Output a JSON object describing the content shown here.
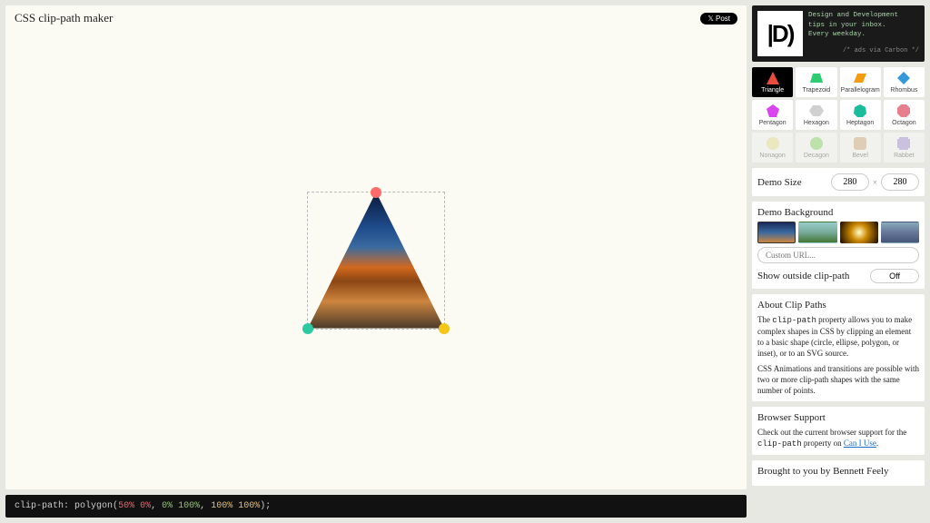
{
  "header": {
    "title": "CSS clip-path maker",
    "post_label": "Post"
  },
  "ad": {
    "line1": "Design and Development",
    "line2": "tips in your inbox.",
    "line3": "Every weekday.",
    "via": "/* ads via Carbon */"
  },
  "shapes": [
    {
      "name": "Triangle",
      "color": "#e74c3c",
      "active": true
    },
    {
      "name": "Trapezoid",
      "color": "#2ecc71"
    },
    {
      "name": "Parallelogram",
      "color": "#f39c12"
    },
    {
      "name": "Rhombus",
      "color": "#3498db"
    },
    {
      "name": "Pentagon",
      "color": "#d946ef"
    },
    {
      "name": "Hexagon",
      "color": "#d0d0d0"
    },
    {
      "name": "Heptagon",
      "color": "#1abc9c"
    },
    {
      "name": "Octagon",
      "color": "#e67e8e"
    },
    {
      "name": "Nonagon",
      "color": "#f0e68c",
      "faded": true
    },
    {
      "name": "Decagon",
      "color": "#7ed957",
      "faded": true
    },
    {
      "name": "Bevel",
      "color": "#d2a679",
      "faded": true
    },
    {
      "name": "Rabbet",
      "color": "#9b89d6",
      "faded": true
    }
  ],
  "demo_size": {
    "label": "Demo Size",
    "w": "280",
    "h": "280"
  },
  "bg": {
    "label": "Demo Background",
    "placeholder": "Custom URL...",
    "toggle_label": "Show outside clip-path",
    "toggle_state": "Off"
  },
  "about": {
    "heading": "About Clip Paths",
    "p1a": "The ",
    "p1code": "clip-path",
    "p1b": " property allows you to make complex shapes in CSS by clipping an element to a basic shape (circle, ellipse, polygon, or inset), or to an SVG source.",
    "p2": "CSS Animations and transitions are possible with two or more clip-path shapes with the same number of points."
  },
  "support": {
    "heading": "Browser Support",
    "pa": "Check out the current browser support for the ",
    "pcode": "clip-path",
    "pb": " property on ",
    "link": "Can I Use"
  },
  "credit": {
    "heading": "Brought to you by Bennett Feely"
  },
  "code": {
    "prop": "clip-path",
    "fn": "polygon",
    "v1a": "50%",
    "v1b": "0%",
    "v2a": "0%",
    "v2b": "100%",
    "v3a": "100%",
    "v3b": "100%"
  }
}
